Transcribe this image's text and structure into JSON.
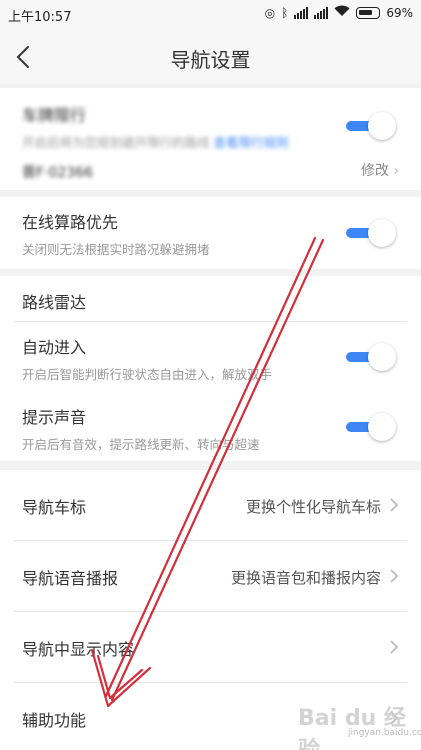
{
  "status_bar": {
    "time": "上午10:57",
    "battery": "69%"
  },
  "header": {
    "title": "导航设置"
  },
  "plate_section": {
    "title": "车牌限行",
    "subtitle": "开启后将为您规划避开限行的路线",
    "link": "查看限行规则",
    "plate": "晋F·02366",
    "edit_label": "修改"
  },
  "online_route": {
    "title": "在线算路优先",
    "subtitle": "关闭则无法根据实时路况躲避拥堵"
  },
  "route_radar": {
    "title": "路线雷达",
    "auto_enter": {
      "title": "自动进入",
      "subtitle": "开启后智能判断行驶状态自由进入，解放双手"
    },
    "sound": {
      "title": "提示声音",
      "subtitle": "开启后有音效，提示路线更新、转向与超速"
    }
  },
  "menu": [
    {
      "label": "导航车标",
      "value": "更换个性化导航车标"
    },
    {
      "label": "导航语音播报",
      "value": "更换语音包和播报内容"
    },
    {
      "label": "导航中显示内容",
      "value": ""
    },
    {
      "label": "辅助功能",
      "value": ""
    }
  ],
  "watermark": {
    "brand": "Bai du 经验",
    "url": "jingyan.baidu.com"
  },
  "colors": {
    "accent": "#3d86f5",
    "annotation_arrow": "#d32f3a"
  }
}
